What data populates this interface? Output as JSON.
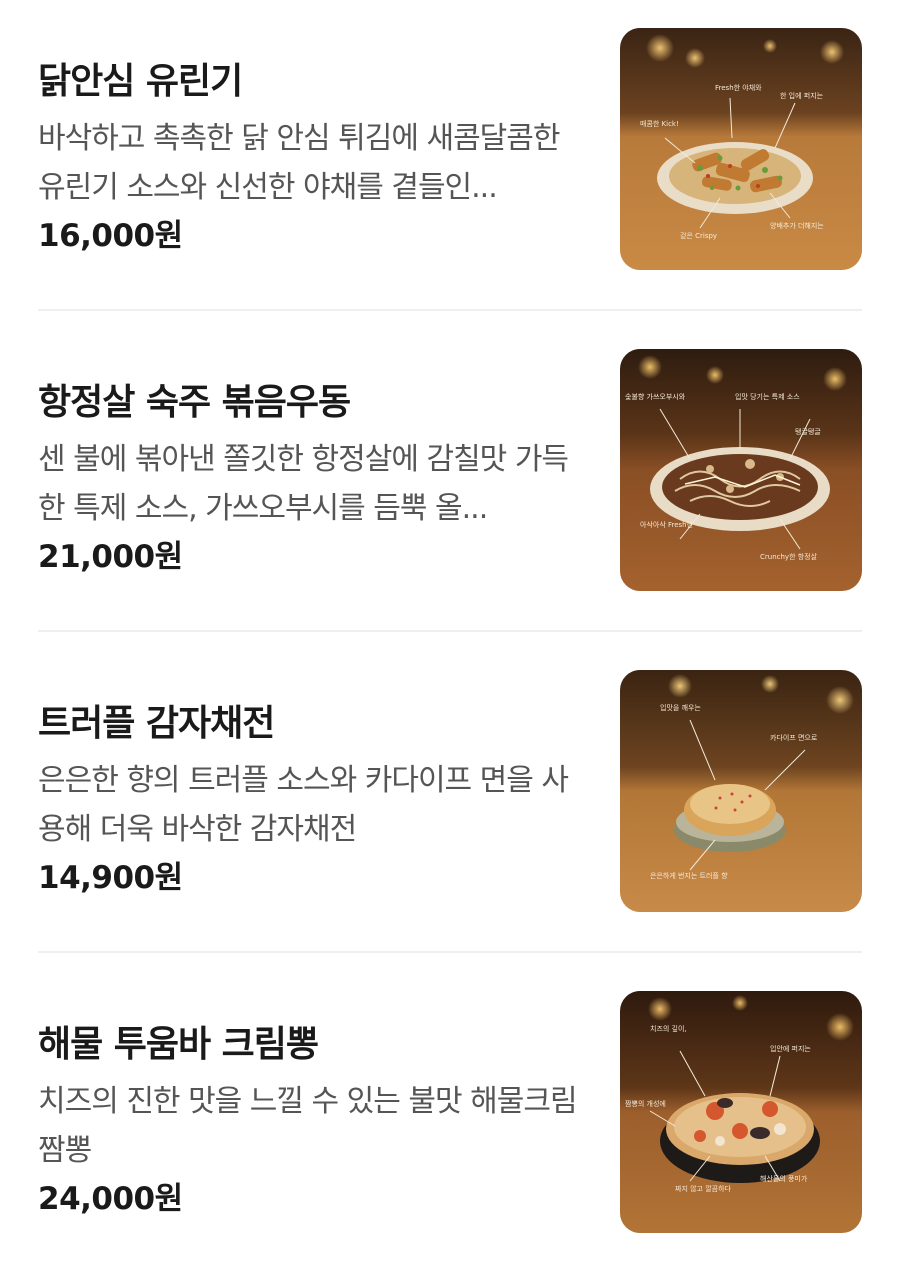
{
  "menu": {
    "items": [
      {
        "name": "닭안심 유린기",
        "description": "바삭하고 촉촉한 닭 안심 튀김에 새콤달콤한 유린기 소스와 신선한 야채를 곁들인...",
        "price": "16,000원",
        "image_notes": [
          "Fresh한 야채와 깔끔한 밸런스",
          "한 입에 퍼지는 새콤달콤 소스",
          "매콤한 Kick! 청양고추 토핑",
          "겉은 Crispy 속은 촉촉 닭안심",
          "양배추가 더해지는 아삭한 식감"
        ]
      },
      {
        "name": "항정살 숙주 볶음우동",
        "description": "센 불에 볶아낸 쫄깃한 항정살에 감칠맛 가득한 특제 소스, 가쓰오부시를 듬뿍 올...",
        "price": "21,000원",
        "image_notes": [
          "숯불향 가쓰오부시와 마요네즈의 고소한 풍미",
          "입맛 당기는 특제 소스가 화려한 느낌",
          "탱글탱글 오는 어묵은 Creamy한 볶음면",
          "아삭아삭 Fresh한 식감의 숙주 듬뿍!",
          "그릴드 Crunchy한 식감의 항정살"
        ]
      },
      {
        "name": "트러플 감자채전",
        "description": "은은한 향의 트러플 소스와 카다이프 면을 사용해 더욱 바삭한 감자채전",
        "price": "14,900원",
        "image_notes": [
          "입맛을 깨우는 매콤함이 살짝",
          "카다이프 면으로 만들어낸 바삭함",
          "은은하게 번지는 트러플 향"
        ]
      },
      {
        "name": "해물 투움바 크림뽕",
        "description": "치즈의 진한 맛을 느낄 수 있는 불맛 해물크림 짬뽕",
        "price": "24,000원",
        "image_notes": [
          "치즈의 깊이 Creamy함 한 가득",
          "입안에 퍼지는 불맛 한 스푼",
          "짬뽕의 개성에 크림을 더하다",
          "짜지 않고 깔끔하다",
          "해산물의 풍미가 국물 속에 가득"
        ]
      }
    ]
  },
  "colors": {
    "title": "#1a1a1a",
    "description": "#555555",
    "divider": "#efefef",
    "photo_warm": "#b8722e"
  }
}
